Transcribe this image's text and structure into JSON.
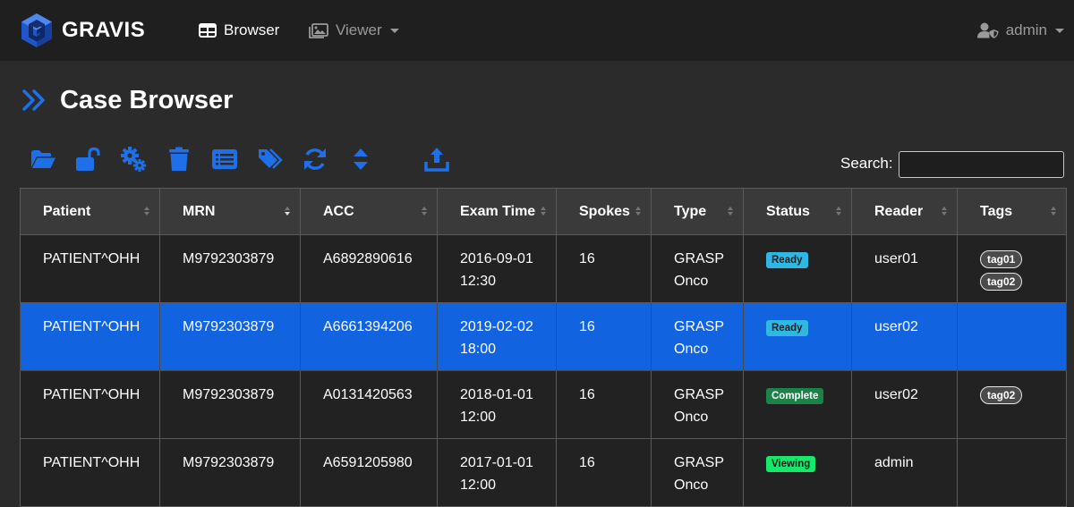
{
  "app": {
    "brand": "GRAVIS",
    "accent": "#1e6fe8"
  },
  "nav": {
    "browser_label": "Browser",
    "viewer_label": "Viewer",
    "user_label": "admin"
  },
  "page": {
    "title": "Case Browser"
  },
  "toolbar": {
    "icons": [
      "folder-open-icon",
      "unlock-icon",
      "cogs-icon",
      "trash-icon",
      "list-icon",
      "tags-icon",
      "sync-icon",
      "sort-icon",
      "upload-icon"
    ],
    "search_label": "Search:",
    "search_value": ""
  },
  "table": {
    "columns": [
      "Patient",
      "MRN",
      "ACC",
      "Exam Time",
      "Spokes",
      "Type",
      "Status",
      "Reader",
      "Tags"
    ],
    "rows": [
      {
        "patient": "PATIENT^OHH",
        "mrn": "M9792303879",
        "acc": "A6892890616",
        "date": "2016-09-01",
        "time": "12:30",
        "spokes": "16",
        "type1": "GRASP",
        "type2": "Onco",
        "status": "Ready",
        "status_color": "#31b7e4",
        "reader": "user01",
        "tags": [
          "tag01",
          "tag02"
        ]
      },
      {
        "patient": "PATIENT^OHH",
        "mrn": "M9792303879",
        "acc": "A6661394206",
        "date": "2019-02-02",
        "time": "18:00",
        "spokes": "16",
        "type1": "GRASP",
        "type2": "Onco",
        "status": "Ready",
        "status_color": "#31b7e4",
        "reader": "user02",
        "tags": [],
        "selected": true
      },
      {
        "patient": "PATIENT^OHH",
        "mrn": "M9792303879",
        "acc": "A0131420563",
        "date": "2018-01-01",
        "time": "12:00",
        "spokes": "16",
        "type1": "GRASP",
        "type2": "Onco",
        "status": "Complete",
        "status_color": "#1b8248",
        "reader": "user02",
        "tags": [
          "tag02"
        ]
      },
      {
        "patient": "PATIENT^OHH",
        "mrn": "M9792303879",
        "acc": "A6591205980",
        "date": "2017-01-01",
        "time": "12:00",
        "spokes": "16",
        "type1": "GRASP",
        "type2": "Onco",
        "status": "Viewing",
        "status_color": "#16e86b",
        "reader": "admin",
        "tags": []
      }
    ]
  }
}
